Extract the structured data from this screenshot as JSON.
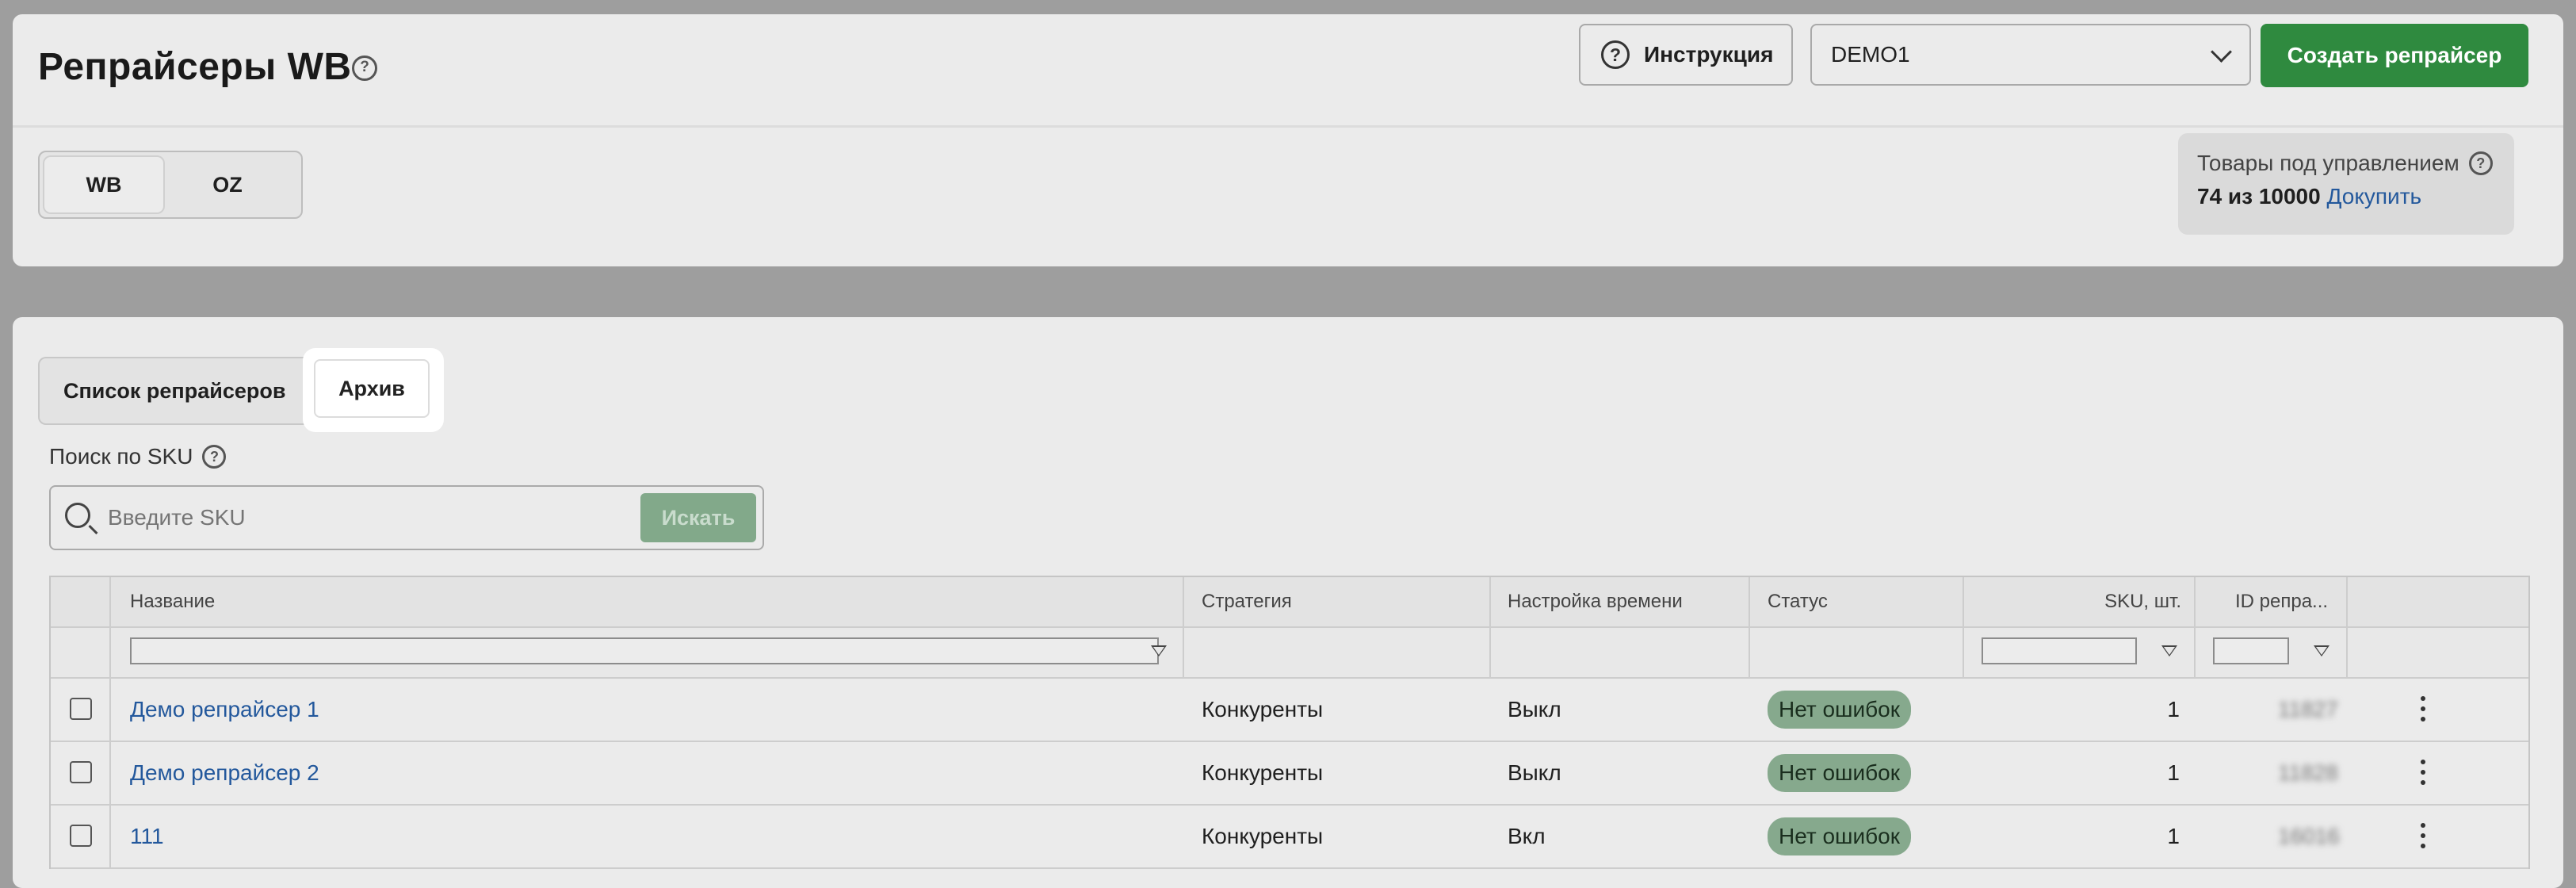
{
  "header": {
    "title": "Репрайсеры WB",
    "instruction_label": "Инструкция",
    "account_value": "DEMO1",
    "create_label": "Создать репрайсер"
  },
  "marketplace_toggle": {
    "options": [
      "WB",
      "OZ"
    ],
    "selected": "WB"
  },
  "quota": {
    "title": "Товары под управлением",
    "count": "74 из 10000",
    "buy_label": "Докупить"
  },
  "tabs": [
    {
      "label": "Список репрайсеров"
    },
    {
      "label": "Архив",
      "active": true
    }
  ],
  "search": {
    "label": "Поиск по SKU",
    "placeholder": "Введите SKU",
    "button_label": "Искать"
  },
  "table": {
    "columns": [
      "Название",
      "Стратегия",
      "Настройка времени",
      "Статус",
      "SKU, шт.",
      "ID репра..."
    ],
    "rows": [
      {
        "name": "Демо репрайсер 1",
        "strategy": "Конкуренты",
        "time": "Выкл",
        "status": "Нет ошибок",
        "sku": "1",
        "id": "11827"
      },
      {
        "name": "Демо репрайсер 2",
        "strategy": "Конкуренты",
        "time": "Выкл",
        "status": "Нет ошибок",
        "sku": "1",
        "id": "11828"
      },
      {
        "name": "111",
        "strategy": "Конкуренты",
        "time": "Вкл",
        "status": "Нет ошибок",
        "sku": "1",
        "id": "16016"
      }
    ]
  },
  "colors": {
    "accent_green": "#2f8a3f",
    "link_blue": "#23589c",
    "badge_green": "#86a98d"
  }
}
